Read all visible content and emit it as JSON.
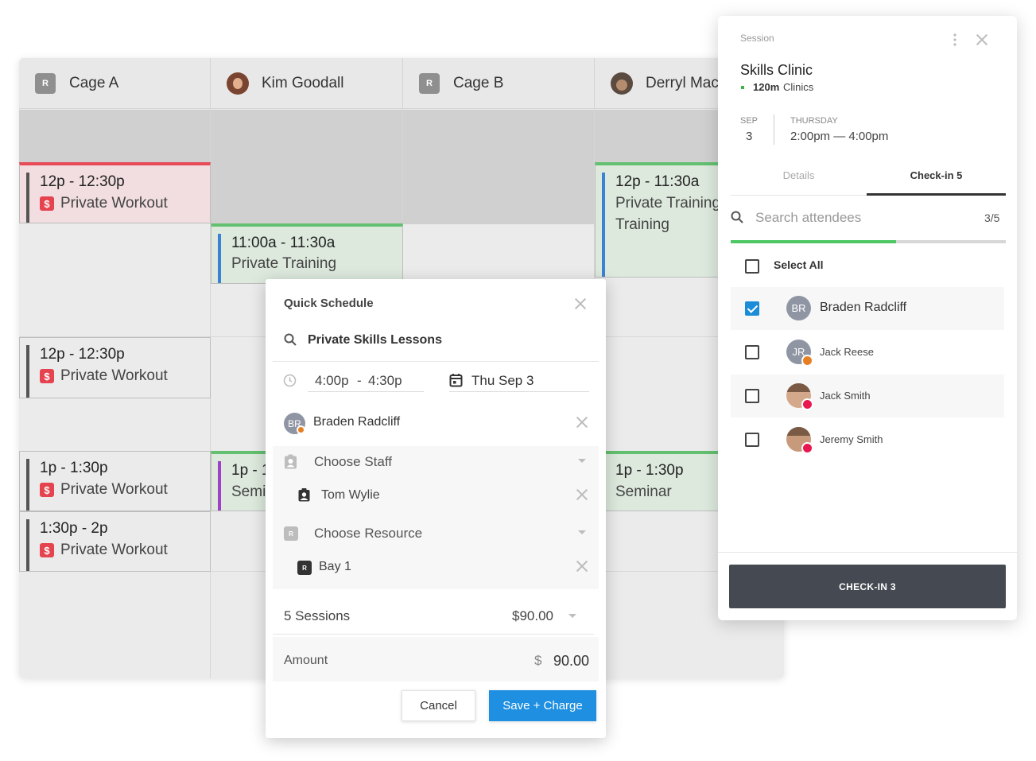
{
  "calendar": {
    "columns": [
      {
        "name": "Cage A",
        "badge": "R"
      },
      {
        "name": "Kim Goodall"
      },
      {
        "name": "Cage B",
        "badge": "R"
      },
      {
        "name": "Derryl Mac"
      }
    ],
    "events": [
      {
        "time": "12p - 12:30p",
        "title": "Private Workout"
      },
      {
        "time": "11:00a - 11:30a",
        "title": "Private Training"
      },
      {
        "time": "12p - 11:30a",
        "title": "Private Training",
        "title2": "Training"
      },
      {
        "time": "12p - 12:30p",
        "title": "Private Workout"
      },
      {
        "time": "1p - 1:30p",
        "title": "Private Workout"
      },
      {
        "time": "1p - 1",
        "title": "Semi"
      },
      {
        "time": "1p - 1:30p",
        "title": "Seminar"
      },
      {
        "time": "1:30p - 2p",
        "title": "Private Workout"
      }
    ],
    "dollar_icon": "$"
  },
  "quick_schedule": {
    "title": "Quick Schedule",
    "service": "Private Skills Lessons",
    "start_time": "4:00p",
    "time_sep": "-",
    "end_time": "4:30p",
    "date": "Thu Sep 3",
    "client": {
      "initials": "BR",
      "name": "Braden Radcliff"
    },
    "staff_placeholder": "Choose Staff",
    "staff_selected": "Tom Wylie",
    "resource_placeholder": "Choose Resource",
    "resource_badge": "R",
    "resource_selected": "Bay 1",
    "sessions_label": "5 Sessions",
    "sessions_price": "$90.00",
    "amount_label": "Amount",
    "amount_currency": "$",
    "amount_value": "90.00",
    "cancel_label": "Cancel",
    "save_label": "Save + Charge",
    "accent": "#1e8fe1"
  },
  "session": {
    "label": "Session",
    "title": "Skills Clinic",
    "duration": "120m",
    "category": "Clinics",
    "month": "SEP",
    "day": "3",
    "weekday": "THURSDAY",
    "time_range": "2:00pm — 4:00pm",
    "tabs": [
      {
        "label": "Details"
      },
      {
        "label": "Check-in 5"
      }
    ],
    "search_placeholder": "Search attendees",
    "count": "3/5",
    "select_all": "Select All",
    "attendees": [
      {
        "name": "Braden Radcliff",
        "initials": "BR",
        "checked": true
      },
      {
        "name": "Jack Reese",
        "initials": "JR",
        "checked": false
      },
      {
        "name": "Jack Smith",
        "checked": false
      },
      {
        "name": "Jeremy Smith",
        "checked": false
      }
    ],
    "checkin_label": "CHECK-IN 3",
    "progress": 0.6
  }
}
